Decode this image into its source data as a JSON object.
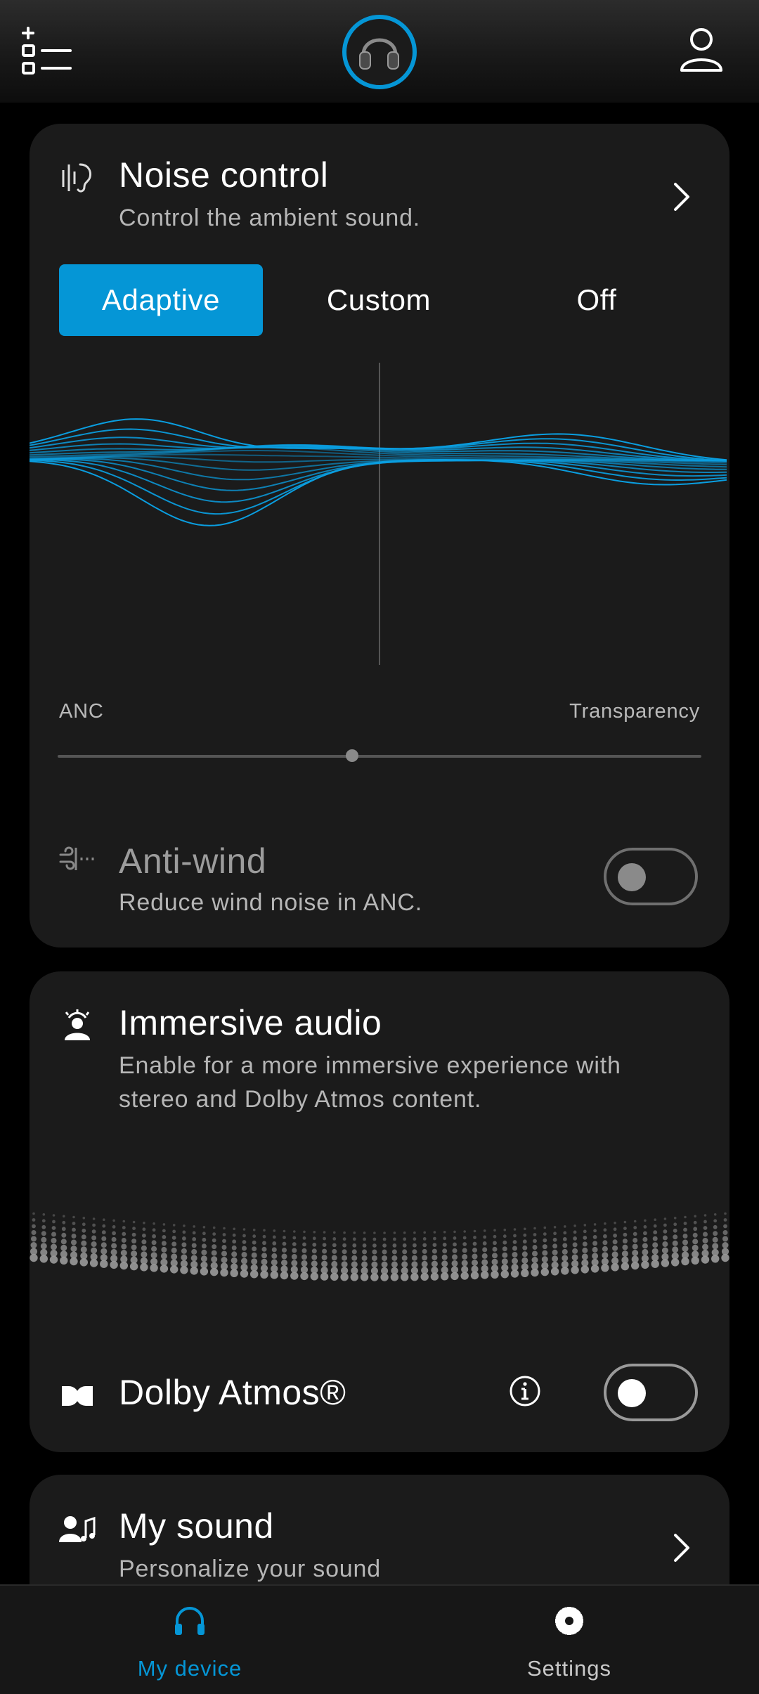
{
  "colors": {
    "accent": "#0596d6",
    "card": "#1b1b1b",
    "background": "#000000"
  },
  "topbar": {
    "menu_icon": "add-list-icon",
    "device_icon": "headphones-avatar-icon",
    "profile_icon": "user-icon"
  },
  "noise_control": {
    "icon": "ear-sound-icon",
    "title": "Noise control",
    "subtitle": "Control the ambient sound.",
    "modes": [
      "Adaptive",
      "Custom",
      "Off"
    ],
    "selected_mode": "Adaptive",
    "left_label": "ANC",
    "right_label": "Transparency",
    "slider_value": 0.5,
    "anti_wind": {
      "icon": "wind-icon",
      "title": "Anti-wind",
      "subtitle": "Reduce wind noise in ANC.",
      "enabled": false
    }
  },
  "immersive_audio": {
    "icon": "immersive-person-icon",
    "title": "Immersive audio",
    "subtitle_line1": "Enable for a more immersive experience with",
    "subtitle_line2": "stereo and Dolby Atmos content.",
    "dolby": {
      "icon": "dolby-icon",
      "label": "Dolby Atmos®",
      "info_icon": "info-icon",
      "enabled": false
    }
  },
  "my_sound": {
    "icon": "person-music-icon",
    "title": "My sound",
    "subtitle": "Personalize your sound"
  },
  "bottom_nav": {
    "items": [
      {
        "label": "My device",
        "icon": "headphones-icon",
        "active": true,
        "color": "#0596d6"
      },
      {
        "label": "Settings",
        "icon": "gear-icon",
        "active": false,
        "color": "#c9c9c9"
      }
    ]
  }
}
